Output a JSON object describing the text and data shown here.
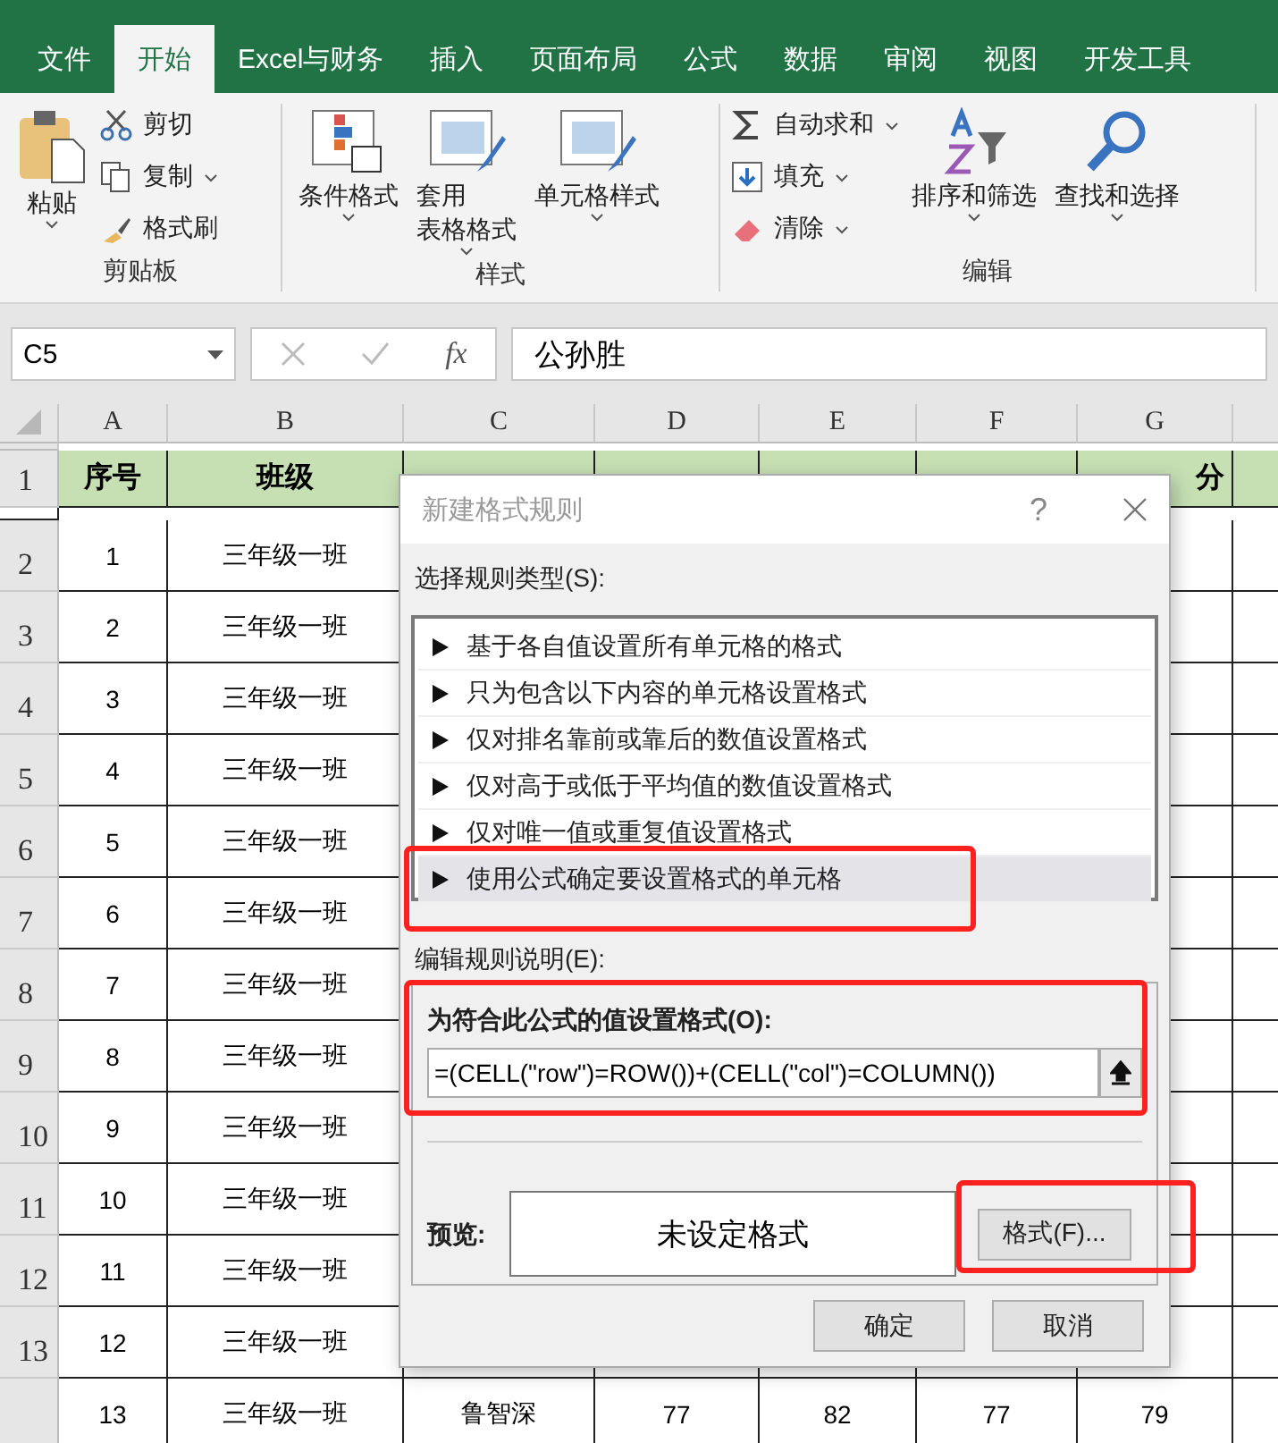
{
  "ribbon": {
    "tabs": [
      {
        "label": "文件",
        "selected": false
      },
      {
        "label": "开始",
        "selected": true
      },
      {
        "label": "Excel与财务",
        "selected": false
      },
      {
        "label": "插入",
        "selected": false
      },
      {
        "label": "页面布局",
        "selected": false
      },
      {
        "label": "公式",
        "selected": false
      },
      {
        "label": "数据",
        "selected": false
      },
      {
        "label": "审阅",
        "selected": false
      },
      {
        "label": "视图",
        "selected": false
      },
      {
        "label": "开发工具",
        "selected": false
      }
    ],
    "clipboard": {
      "label": "剪贴板",
      "paste": "粘贴",
      "small": [
        "剪切",
        "复制",
        "格式刷"
      ]
    },
    "styles": {
      "label": "样式",
      "buttons": [
        [
          "条件格式"
        ],
        [
          "套用",
          "表格格式"
        ],
        [
          "单元格样式"
        ]
      ]
    },
    "editing": {
      "label": "编辑",
      "small": [
        "自动求和",
        "填充",
        "清除"
      ],
      "big": [
        "排序和筛选",
        "查找和选择"
      ]
    }
  },
  "formula_bar": {
    "name_box": "C5",
    "fx": "fx",
    "value": "公孙胜"
  },
  "sheet": {
    "columns": [
      "A",
      "B",
      "C",
      "D",
      "E",
      "F",
      "G"
    ],
    "header_row": {
      "number": "1",
      "cells": [
        "序号",
        "班级"
      ],
      "last_visible": "分"
    },
    "rows": [
      {
        "number": "2",
        "cells": [
          "1",
          "三年级一班"
        ]
      },
      {
        "number": "3",
        "cells": [
          "2",
          "三年级一班"
        ]
      },
      {
        "number": "4",
        "cells": [
          "3",
          "三年级一班"
        ]
      },
      {
        "number": "5",
        "cells": [
          "4",
          "三年级一班"
        ]
      },
      {
        "number": "6",
        "cells": [
          "5",
          "三年级一班"
        ]
      },
      {
        "number": "7",
        "cells": [
          "6",
          "三年级一班"
        ]
      },
      {
        "number": "8",
        "cells": [
          "7",
          "三年级一班"
        ]
      },
      {
        "number": "9",
        "cells": [
          "8",
          "三年级一班"
        ]
      },
      {
        "number": "10",
        "cells": [
          "9",
          "三年级一班"
        ]
      },
      {
        "number": "11",
        "cells": [
          "10",
          "三年级一班"
        ]
      },
      {
        "number": "12",
        "cells": [
          "11",
          "三年级一班"
        ]
      },
      {
        "number": "13",
        "cells": [
          "12",
          "三年级一班"
        ]
      },
      {
        "cells": [
          "13",
          "三年级一班",
          "鲁智深",
          "77",
          "82",
          "77",
          "79"
        ]
      }
    ]
  },
  "dialog": {
    "title": "新建格式规则",
    "help": "?",
    "rule_type_label": "选择规则类型(S):",
    "rule_types": [
      {
        "label": "基于各自值设置所有单元格的格式",
        "selected": false
      },
      {
        "label": "只为包含以下内容的单元格设置格式",
        "selected": false
      },
      {
        "label": "仅对排名靠前或靠后的数值设置格式",
        "selected": false
      },
      {
        "label": "仅对高于或低于平均值的数值设置格式",
        "selected": false
      },
      {
        "label": "仅对唯一值或重复值设置格式",
        "selected": false
      },
      {
        "label": "使用公式确定要设置格式的单元格",
        "selected": true
      }
    ],
    "edit_label": "编辑规则说明(E):",
    "formula_label": "为符合此公式的值设置格式(O):",
    "formula": "=(CELL(\"row\")=ROW())+(CELL(\"col\")=COLUMN())",
    "preview_label": "预览:",
    "preview_text": "未设定格式",
    "format_button": "格式(F)...",
    "ok": "确定",
    "cancel": "取消"
  }
}
